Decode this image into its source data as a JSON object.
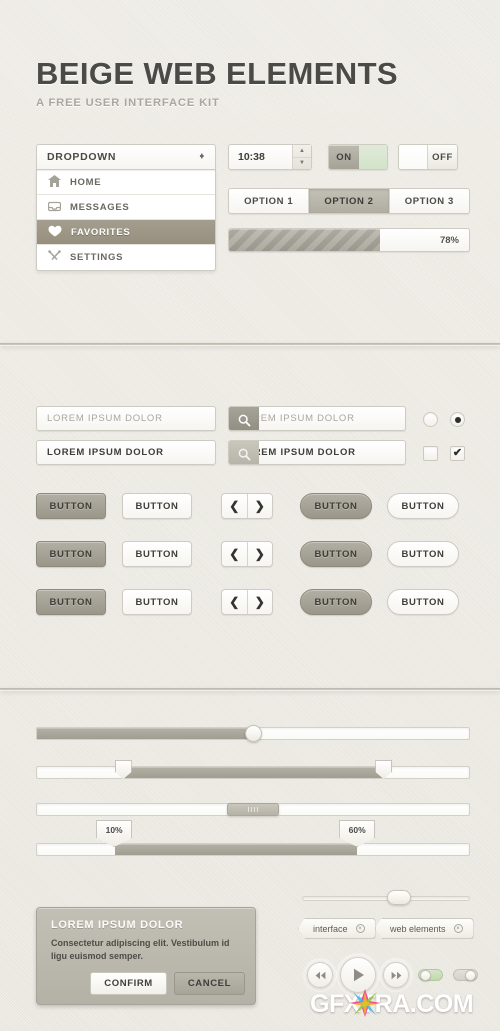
{
  "header": {
    "title": "BEIGE WEB ELEMENTS",
    "subtitle": "A FREE USER INTERFACE KIT"
  },
  "dropdown": {
    "label": "DROPDOWN",
    "items": [
      {
        "label": "HOME",
        "icon": "home-icon"
      },
      {
        "label": "MESSAGES",
        "icon": "inbox-icon"
      },
      {
        "label": "FAVORITES",
        "icon": "heart-icon"
      },
      {
        "label": "SETTINGS",
        "icon": "tools-icon"
      }
    ],
    "active_index": 2
  },
  "spinner": {
    "value": "10:38"
  },
  "toggles": {
    "on_label": "ON",
    "off_label": "OFF",
    "on_track_color": "#d3e3c9"
  },
  "segmented": {
    "options": [
      "OPTION 1",
      "OPTION 2",
      "OPTION 3"
    ],
    "selected_index": 1
  },
  "progress": {
    "label": "78%",
    "percent": 63
  },
  "inputs": {
    "placeholder_text": "LOREM IPSUM DOLOR",
    "filled_text": "LOREM IPSUM DOLOR",
    "search_placeholder": "LOREM IPSUM DOLOR",
    "search_filled": "LOREM IPSUM DOLOR"
  },
  "checks": {
    "check_mark": "✔"
  },
  "buttons": {
    "label": "BUTTON",
    "prev_icon": "❮",
    "next_icon": "❯"
  },
  "sliders": {
    "s1_percent": 50,
    "s2_from": 20,
    "s2_to": 80,
    "s3_percent": 50,
    "s4_from_label": "10%",
    "s4_to_label": "60%",
    "s4_from": 18,
    "s4_to": 74,
    "thin_percent": 58
  },
  "dialog": {
    "title": "LOREM IPSUM DOLOR",
    "body": "Consectetur adipiscing elit. Vestibulum id ligu euismod semper.",
    "confirm": "CONFIRM",
    "cancel": "CANCEL"
  },
  "tags": [
    {
      "label": "interface",
      "close": "×"
    },
    {
      "label": "web elements",
      "close": "×"
    }
  ],
  "media": {
    "rewind": "◀◀",
    "play": "▶",
    "forward": "▶▶"
  },
  "watermark": {
    "text": "GFXTRA.COM"
  }
}
